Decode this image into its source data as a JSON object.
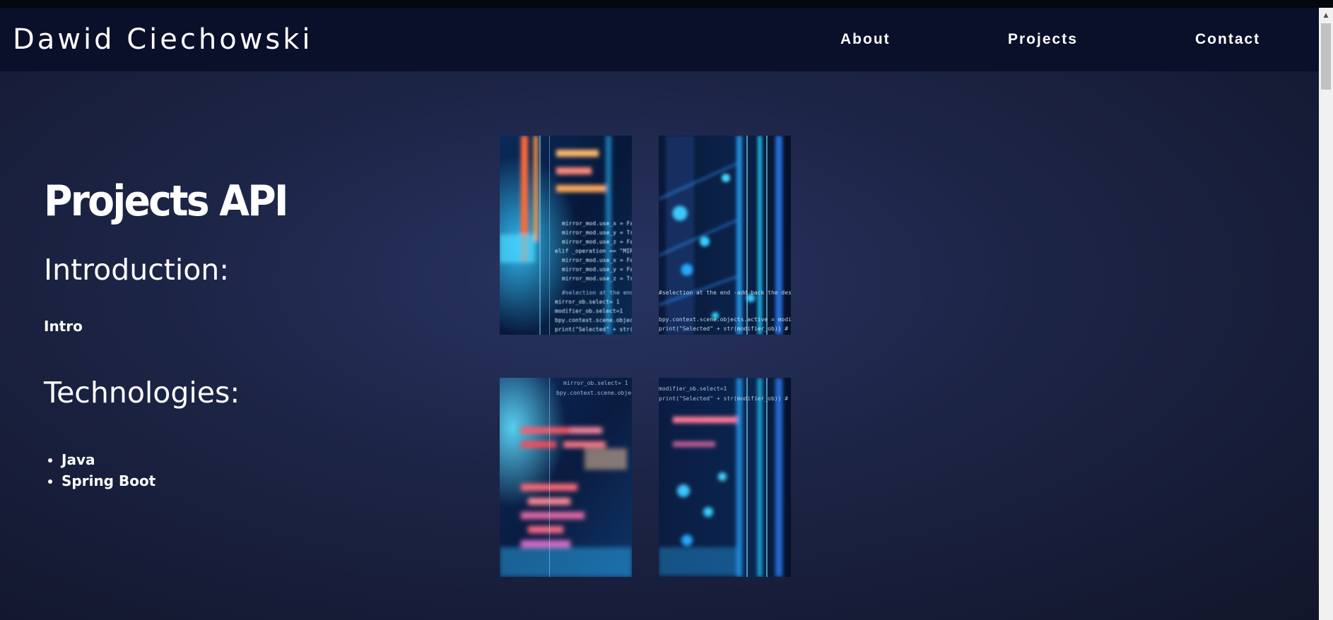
{
  "header": {
    "brand": "Dawid Ciechowski",
    "nav": [
      {
        "label": "About"
      },
      {
        "label": "Projects"
      },
      {
        "label": "Contact"
      }
    ]
  },
  "main": {
    "title": "Projects API",
    "introduction_heading": "Introduction:",
    "introduction_text": "Intro",
    "technologies_heading": "Technologies:",
    "technologies": [
      "Java",
      "Spring Boot"
    ]
  },
  "gallery": {
    "image_subject": "blurred code screen",
    "code_lines": [
      "mirror_mod.use_x = False",
      "mirror_mod.use_y = True",
      "mirror_mod.use_z = False",
      "elif _operation == \"MIRROR_Z\":",
      "mirror_mod.use_x = False",
      "mirror_mod.use_y = False",
      "mirror_mod.use_z = True",
      "#selection at the end -add back the deselected mirror modifier object",
      "mirror_ob.select= 1",
      "modifier_ob.select=1",
      "bpy.context.scene.objects.active = modifier_ob",
      "print(\"Selected\" + str(modifier_ob)) # modifier ob is the active ob"
    ]
  },
  "colors": {
    "navbar": "#0a1029",
    "background": "#1d2547",
    "text": "#ffffff",
    "accent_cyan": "#1ec8ff",
    "accent_orange": "#ff7a3c"
  }
}
